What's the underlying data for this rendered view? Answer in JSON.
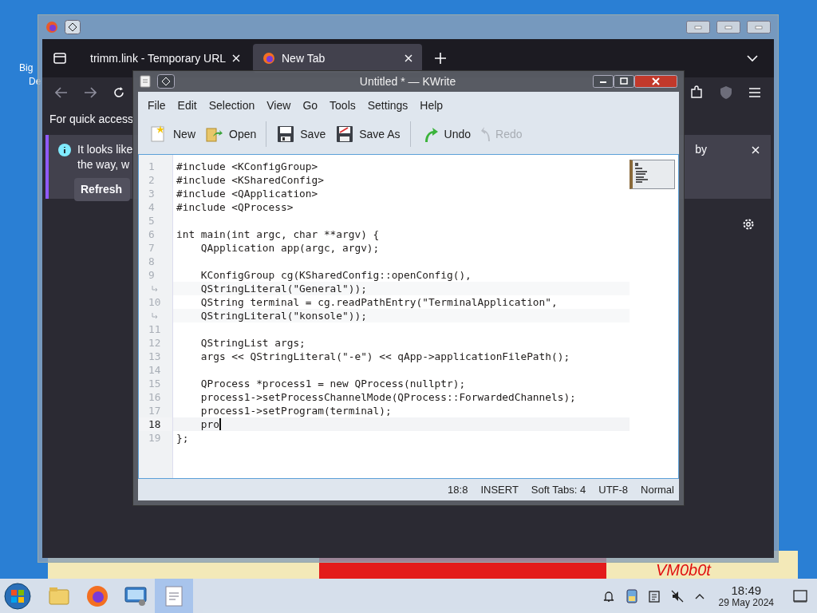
{
  "desktop": {
    "icon_label": "Big",
    "icon_label_2": "De",
    "wallpaper_text": "VM0b0t"
  },
  "browser": {
    "tabs": [
      {
        "label": "trimm.link - Temporary URL",
        "selected": false
      },
      {
        "label": "New Tab",
        "selected": true
      }
    ],
    "quick_access_text": "For quick access",
    "notification": {
      "text_1": "It looks like",
      "text_2": "the way, w",
      "text_3": "by",
      "button": "Refresh"
    }
  },
  "editor": {
    "title": "Untitled * — KWrite",
    "menu": [
      "File",
      "Edit",
      "Selection",
      "View",
      "Go",
      "Tools",
      "Settings",
      "Help"
    ],
    "toolbar": [
      {
        "items": [
          {
            "kind": "new",
            "label": "New",
            "disabled": false
          },
          {
            "kind": "open",
            "label": "Open",
            "disabled": false
          }
        ]
      },
      {
        "items": [
          {
            "kind": "save",
            "label": "Save",
            "disabled": false
          },
          {
            "kind": "saveas",
            "label": "Save As",
            "disabled": false
          }
        ]
      },
      {
        "items": [
          {
            "kind": "undo",
            "label": "Undo",
            "disabled": false
          },
          {
            "kind": "redo",
            "label": "Redo",
            "disabled": true
          }
        ]
      }
    ],
    "lines": [
      {
        "kind": "line",
        "number": "1",
        "text": "#include <KConfigGroup>",
        "current": false
      },
      {
        "kind": "line",
        "number": "2",
        "text": "#include <KSharedConfig>",
        "current": false
      },
      {
        "kind": "line",
        "number": "3",
        "text": "#include <QApplication>",
        "current": false
      },
      {
        "kind": "line",
        "number": "4",
        "text": "#include <QProcess>",
        "current": false
      },
      {
        "kind": "line",
        "number": "5",
        "current": false
      },
      {
        "kind": "line",
        "number": "6",
        "text": "int main(int argc, char **argv) {",
        "current": false
      },
      {
        "kind": "line",
        "number": "7",
        "text": "    QApplication app(argc, argv);",
        "current": false
      },
      {
        "kind": "line",
        "number": "8",
        "current": false
      },
      {
        "kind": "line",
        "number": "9",
        "text": "    KConfigGroup cg(KSharedConfig::openConfig(),",
        "current": false
      },
      {
        "kind": "wrap",
        "text": "    QStringLiteral(\"General\"));",
        "current": false
      },
      {
        "kind": "line",
        "number": "10",
        "text": "    QString terminal = cg.readPathEntry(\"TerminalApplication\",",
        "current": false
      },
      {
        "kind": "wrap",
        "text": "    QStringLiteral(\"konsole\"));",
        "current": false
      },
      {
        "kind": "line",
        "number": "11",
        "current": false
      },
      {
        "kind": "line",
        "number": "12",
        "text": "    QStringList args;",
        "current": false
      },
      {
        "kind": "line",
        "number": "13",
        "text": "    args << QStringLiteral(\"-e\") << qApp->applicationFilePath();",
        "current": false
      },
      {
        "kind": "line",
        "number": "14",
        "current": false
      },
      {
        "kind": "line",
        "number": "15",
        "text": "    QProcess *process1 = new QProcess(nullptr);",
        "current": false
      },
      {
        "kind": "line",
        "number": "16",
        "text": "    process1->setProcessChannelMode(QProcess::ForwardedChannels);",
        "current": false
      },
      {
        "kind": "line",
        "number": "17",
        "text": "    process1->setProgram(terminal);",
        "current": false
      },
      {
        "kind": "line",
        "number": "18",
        "text": "    pro",
        "current": true
      },
      {
        "kind": "line",
        "number": "19",
        "text": "};",
        "current": false
      }
    ],
    "status_bar": [
      "18:8",
      "INSERT",
      "Soft Tabs: 4",
      "UTF-8",
      "Normal"
    ]
  },
  "taskbar": {
    "apps": [
      {
        "kind": "folder",
        "active": false
      },
      {
        "kind": "firefox",
        "active": false
      },
      {
        "kind": "settings",
        "active": false
      },
      {
        "kind": "kwrite",
        "active": true
      }
    ],
    "clock": {
      "time": "18:49",
      "date": "29 May 2024"
    }
  }
}
